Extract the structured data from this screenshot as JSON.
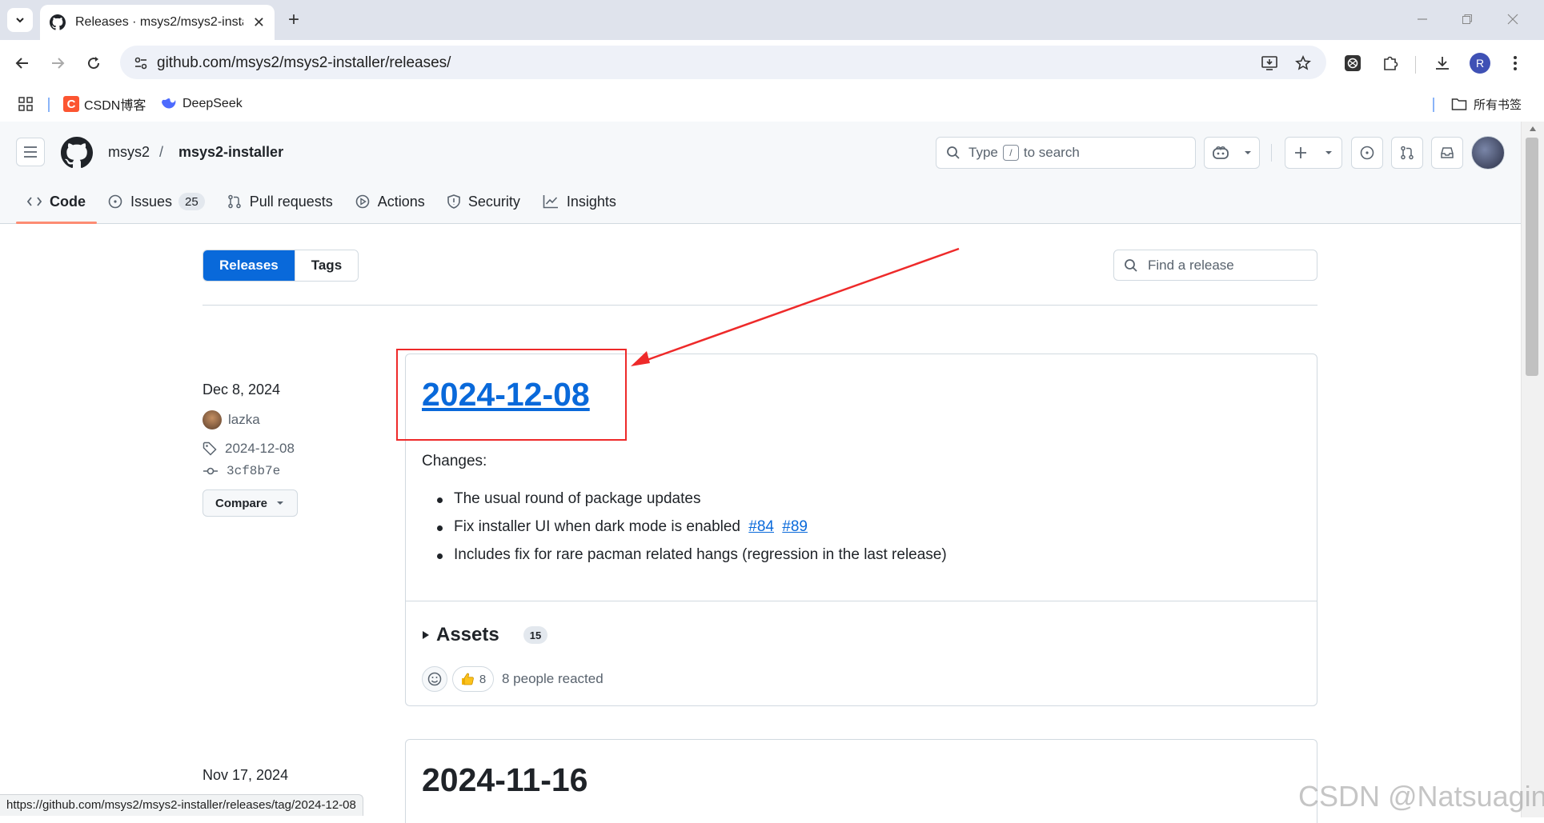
{
  "browser": {
    "tab_title": "Releases · msys2/msys2-installer",
    "url": "github.com/msys2/msys2-installer/releases/",
    "new_tab": "+",
    "close_tab": "✕",
    "profile_initial": "R",
    "bookmarks": [
      {
        "label": "CSDN博客"
      },
      {
        "label": "DeepSeek"
      }
    ],
    "all_bookmarks": "所有书签"
  },
  "github": {
    "owner": "msys2",
    "separator": "/",
    "repo": "msys2-installer",
    "search_prefix": "Type",
    "search_key": "/",
    "search_suffix": "to search",
    "nav": [
      {
        "label": "Code"
      },
      {
        "label": "Issues",
        "count": "25"
      },
      {
        "label": "Pull requests"
      },
      {
        "label": "Actions"
      },
      {
        "label": "Security"
      },
      {
        "label": "Insights"
      }
    ]
  },
  "releases_page": {
    "tabs": {
      "releases": "Releases",
      "tags": "Tags"
    },
    "find_placeholder": "Find a release",
    "releases": [
      {
        "date": "Dec 8, 2024",
        "author": "lazka",
        "tag": "2024-12-08",
        "commit": "3cf8b7e",
        "compare_label": "Compare",
        "title": "2024-12-08",
        "changes_heading": "Changes:",
        "changes": [
          {
            "text": "The usual round of package updates"
          },
          {
            "text": "Fix installer UI when dark mode is enabled",
            "links": [
              "#84",
              "#89"
            ]
          },
          {
            "text": "Includes fix for rare pacman related hangs (regression in the last release)"
          }
        ],
        "assets_label": "Assets",
        "assets_count": "15",
        "reaction_count": "8",
        "reaction_text": "8 people reacted"
      },
      {
        "date": "Nov 17, 2024",
        "title": "2024-11-16"
      }
    ]
  },
  "status_bar_url": "https://github.com/msys2/msys2-installer/releases/tag/2024-12-08",
  "watermark": "CSDN @Natsuagin",
  "colors": {
    "accent": "#0969da",
    "annotation": "#ee2a2a",
    "tab_underline": "#fd8c73"
  }
}
